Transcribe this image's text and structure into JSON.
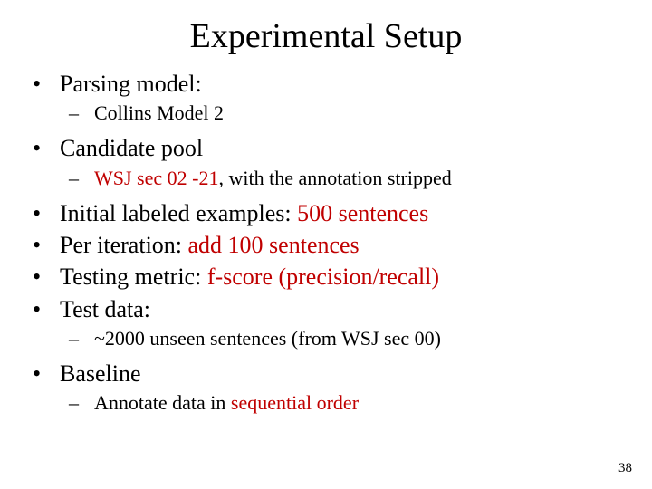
{
  "title": "Experimental Setup",
  "items": {
    "parsing_model": "Parsing model:",
    "parsing_model_sub": "Collins Model 2",
    "candidate_pool": "Candidate pool",
    "candidate_pool_sub_pre": "WSJ sec 02 -21",
    "candidate_pool_sub_post": ", with the annotation stripped",
    "initial_pre": "Initial labeled examples: ",
    "initial_red": "500 sentences",
    "periter_pre": "Per iteration: ",
    "periter_red": "add 100 sentences",
    "metric_pre": "Testing metric: ",
    "metric_red": "f-score (precision/recall)",
    "testdata": "Test data:",
    "testdata_sub": "~2000 unseen sentences (from WSJ sec 00)",
    "baseline": " Baseline",
    "baseline_sub_pre": "Annotate data in ",
    "baseline_sub_red": "sequential order"
  },
  "page_number": "38"
}
